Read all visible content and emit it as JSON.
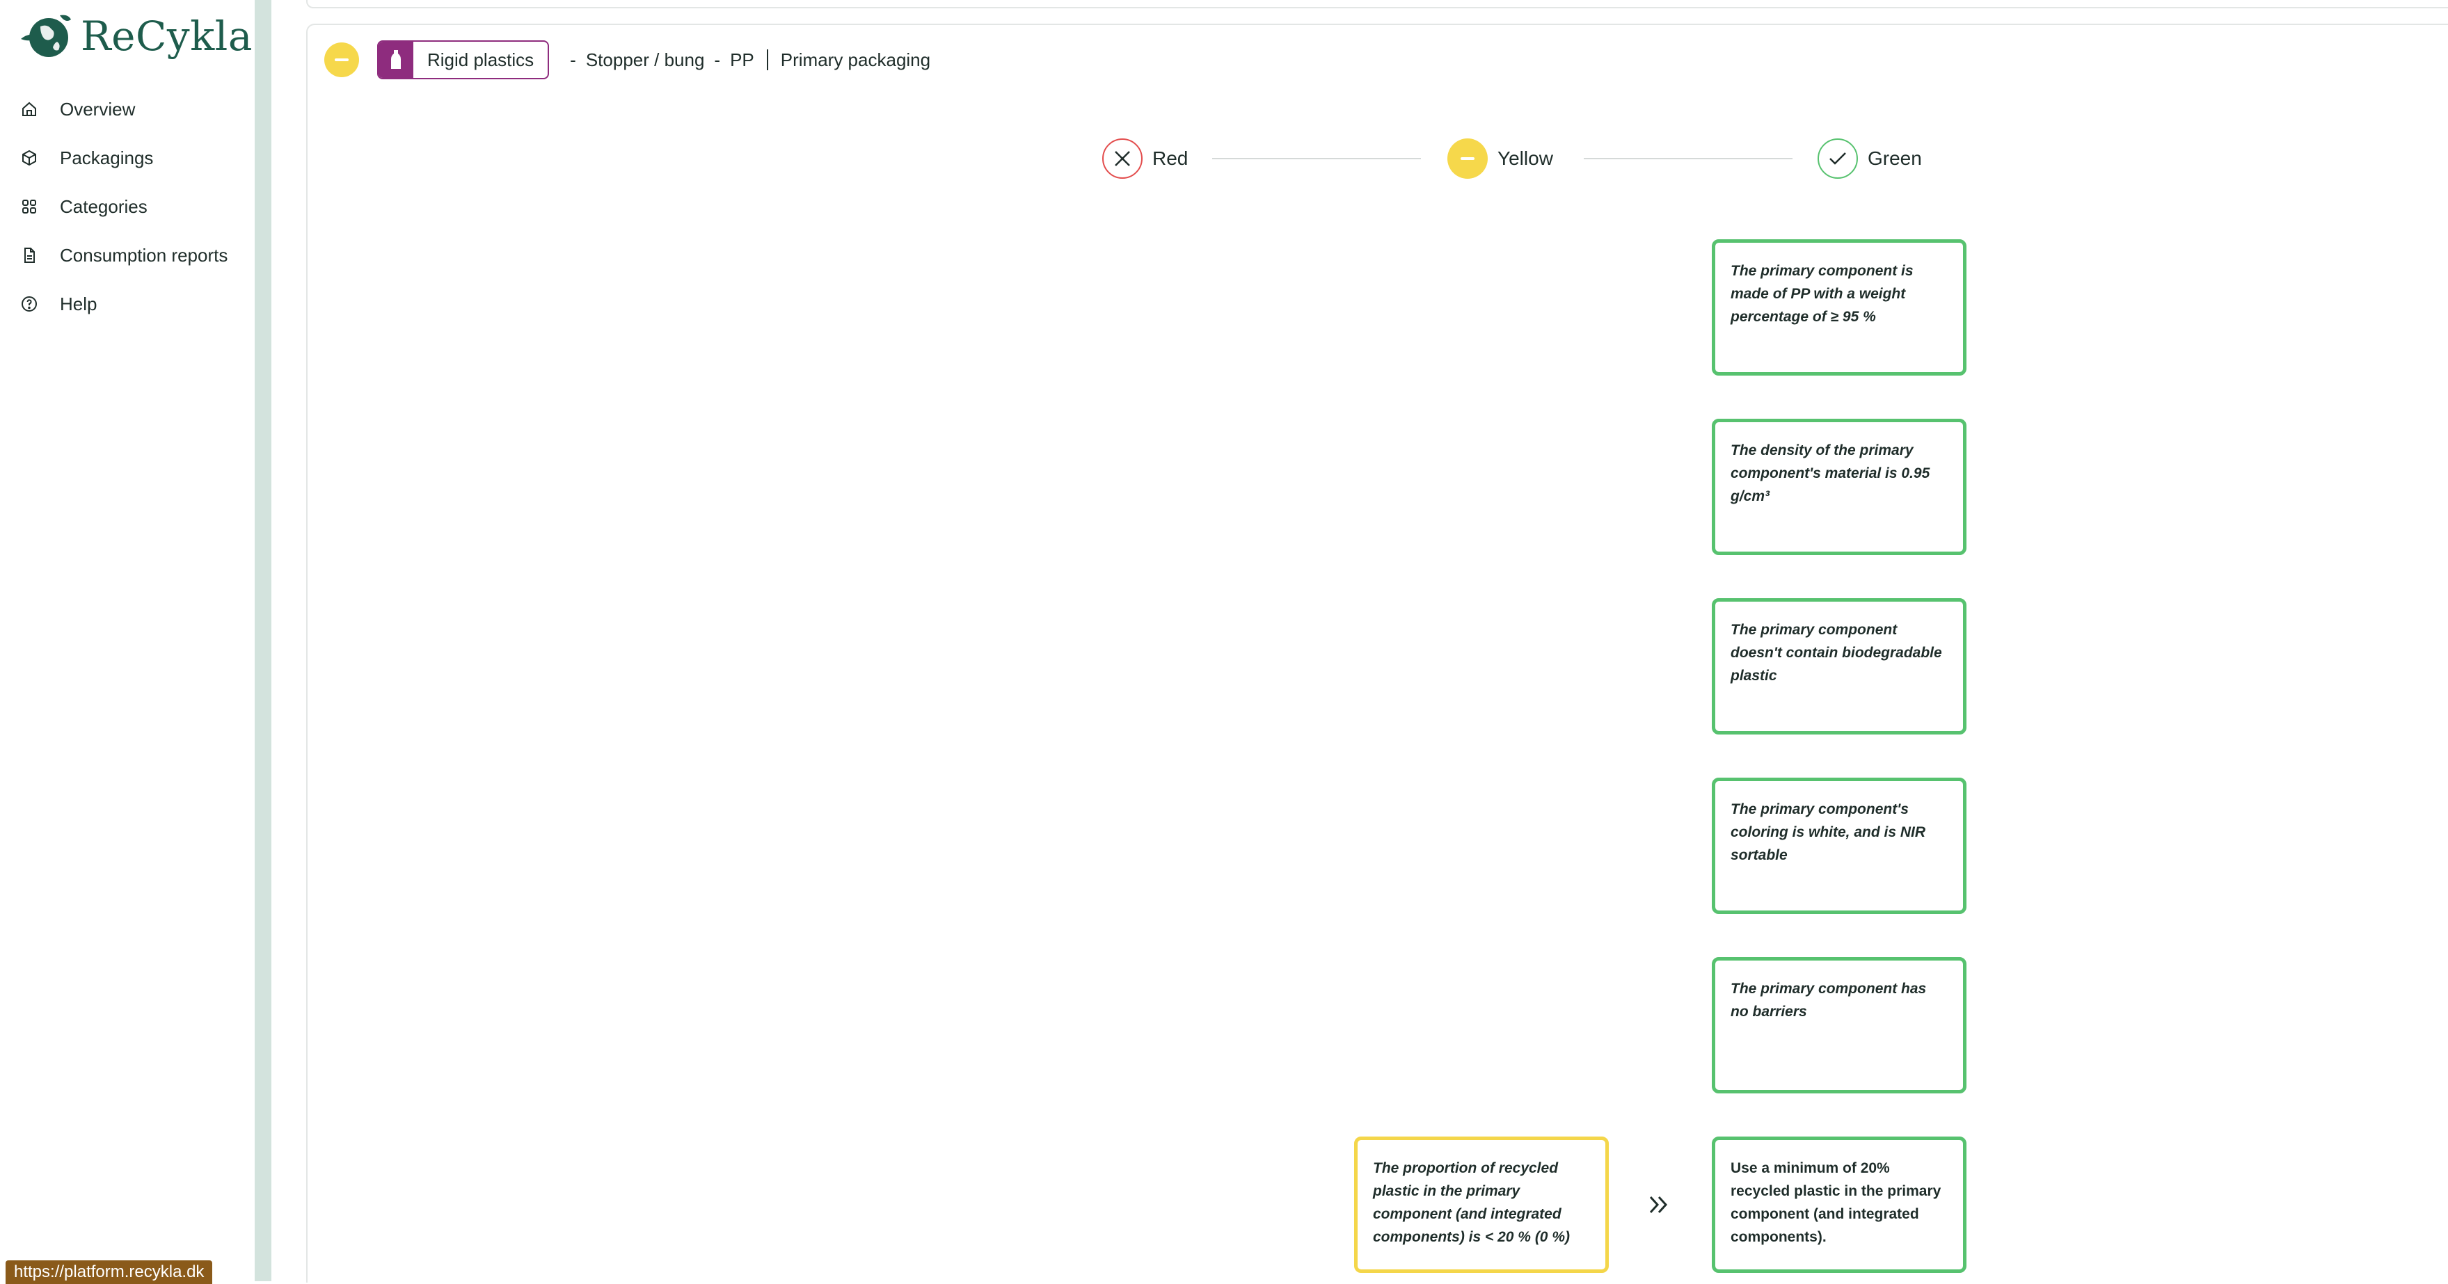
{
  "app": {
    "name": "ReCykla"
  },
  "sidebar": {
    "items": [
      {
        "label": "Overview",
        "icon": "home-icon"
      },
      {
        "label": "Packagings",
        "icon": "box-icon"
      },
      {
        "label": "Categories",
        "icon": "grid-icon"
      },
      {
        "label": "Consumption reports",
        "icon": "document-icon"
      },
      {
        "label": "Help",
        "icon": "help-icon"
      }
    ]
  },
  "status_bar": {
    "url": "https://platform.recykla.dk"
  },
  "breadcrumb": {
    "status_color": "#f6d84b",
    "category_tag": "Rigid plastics",
    "separator": "-",
    "item": "Stopper / bung",
    "material": "PP",
    "packaging_type": "Primary packaging"
  },
  "legend": {
    "red": {
      "label": "Red",
      "color": "#e34d4d"
    },
    "yellow": {
      "label": "Yellow",
      "color": "#f6d84b"
    },
    "green": {
      "label": "Green",
      "color": "#57c26f"
    }
  },
  "criteria": {
    "green": [
      "The primary component is made of PP with a weight percentage of ≥ 95 %",
      "The density of the primary component's material is 0.95 g/cm³",
      "The primary component doesn't contain biodegradable plastic",
      "The primary component's coloring is white, and is NIR sortable",
      "The primary component has no barriers"
    ],
    "yellow_issue": "The proportion of recycled plastic in the primary component (and integrated components) is < 20 % (0 %)",
    "recommendation": "Use a minimum of 20% recycled plastic in the primary component (and integrated components)."
  }
}
